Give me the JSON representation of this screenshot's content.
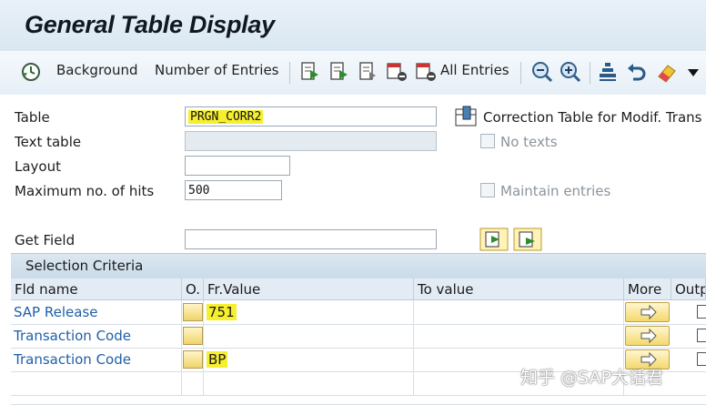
{
  "title": "General Table Display",
  "toolbar": {
    "background_label": "Background",
    "number_of_entries_label": "Number of Entries",
    "all_entries_label": "All Entries"
  },
  "form": {
    "table_label": "Table",
    "table_value": "PRGN_CORR2",
    "table_description": "Correction Table for Modif. Trans",
    "text_table_label": "Text table",
    "no_texts_label": "No texts",
    "layout_label": "Layout",
    "max_hits_label": "Maximum no. of hits",
    "max_hits_value": "500",
    "maintain_entries_label": "Maintain entries",
    "get_field_label": "Get Field"
  },
  "selection": {
    "title": "Selection Criteria",
    "columns": [
      "Fld name",
      "O.",
      "Fr.Value",
      "To value",
      "More",
      "Outp"
    ],
    "rows": [
      {
        "field": "SAP Release",
        "from": "751"
      },
      {
        "field": "Transaction Code",
        "from": ""
      },
      {
        "field": "Transaction Code",
        "from": "BP"
      }
    ]
  },
  "watermark": "知乎 @SAP大话君",
  "colors": {
    "highlight": "#f6ef2f",
    "link": "#1f5fa8",
    "header_bg": "#dbe7f1"
  }
}
